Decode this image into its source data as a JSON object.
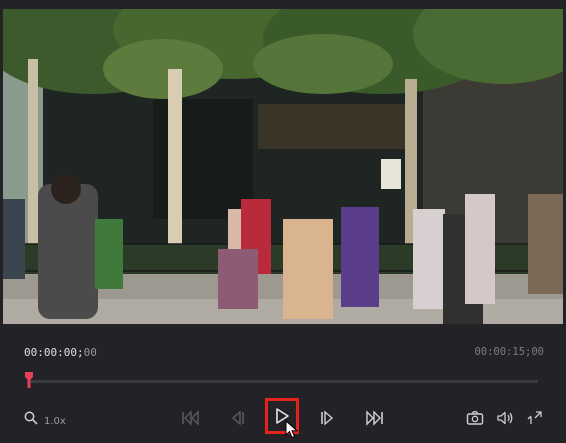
{
  "player": {
    "timecode_current_main": "00:00:00;",
    "timecode_current_frames": "00",
    "timecode_total": "00:00:15;00",
    "playback_progress": 0,
    "zoom_label": "1.0x"
  },
  "controls": {
    "skip_start": "skip-to-start-icon",
    "prev_frame": "previous-frame-icon",
    "play": "play-icon",
    "next_frame": "next-frame-icon",
    "skip_end": "skip-to-end-icon",
    "snapshot": "camera-icon",
    "volume": "speaker-icon",
    "fullscreen": "expand-icon"
  },
  "colors": {
    "accent": "#e3231c",
    "playhead": "#e8405a",
    "background": "#232327",
    "text": "#e0e0e0",
    "text_dim": "#7d7d7d"
  }
}
